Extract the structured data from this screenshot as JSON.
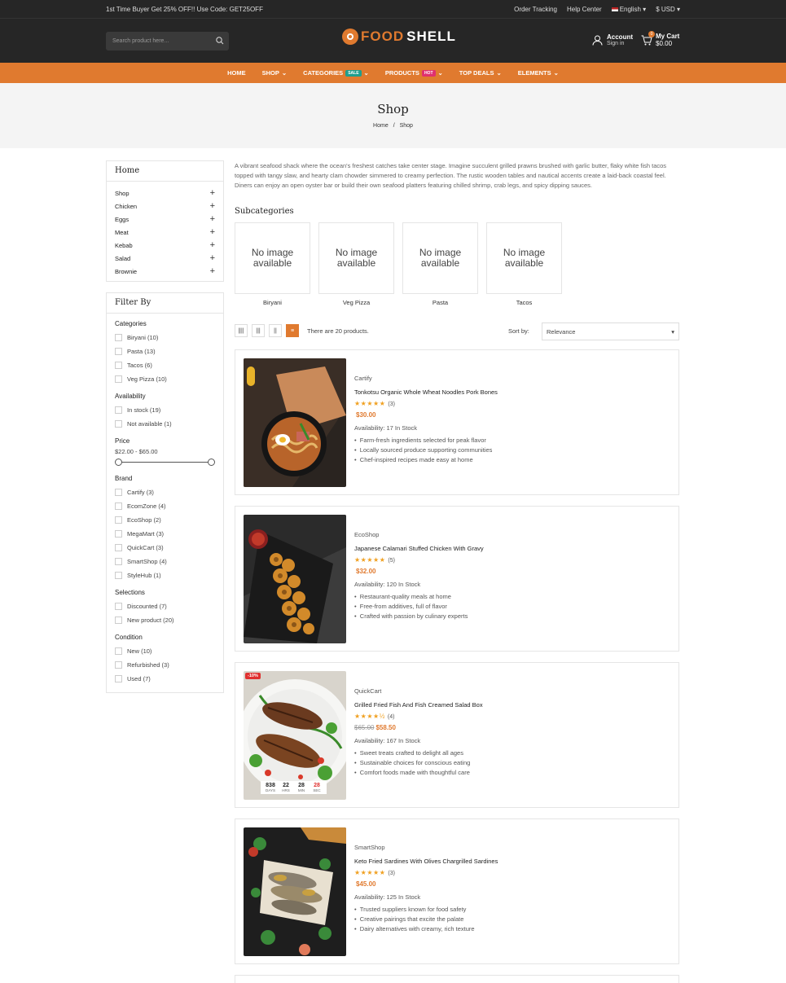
{
  "topbar": {
    "promo": "1st Time Buyer Get 25% OFF!! Use Code: GET25OFF",
    "order_tracking": "Order Tracking",
    "help_center": "Help Center",
    "language": "English",
    "currency": "$ USD"
  },
  "header": {
    "search_placeholder": "Search product here...",
    "logo_part1": "FOOD",
    "logo_part2": "SHELL",
    "account_label": "Account",
    "account_sub": "Sign in",
    "cart_label": "My Cart",
    "cart_total": "$0.00",
    "cart_count": "0"
  },
  "nav": {
    "items": [
      "HOME",
      "SHOP",
      "CATEGORIES",
      "PRODUCTS",
      "TOP DEALS",
      "ELEMENTS"
    ],
    "sale_tag": "SALE",
    "hot_tag": "HOT"
  },
  "banner": {
    "title": "Shop",
    "crumb_home": "Home",
    "crumb_sep": "/",
    "crumb_current": "Shop"
  },
  "sidebar": {
    "cat_title": "Home",
    "categories": [
      "Shop",
      "Chicken",
      "Eggs",
      "Meat",
      "Kebab",
      "Salad",
      "Brownie"
    ],
    "filter_title": "Filter By",
    "groups": {
      "categories": {
        "title": "Categories",
        "options": [
          "Biryani (10)",
          "Pasta (13)",
          "Tacos (6)",
          "Veg Pizza (10)"
        ]
      },
      "availability": {
        "title": "Availability",
        "options": [
          "In stock (19)",
          "Not available (1)"
        ]
      },
      "price": {
        "title": "Price",
        "range": "$22.00 - $65.00"
      },
      "brand": {
        "title": "Brand",
        "options": [
          "Cartify (3)",
          "EcomZone (4)",
          "EcoShop (2)",
          "MegaMart (3)",
          "QuickCart (3)",
          "SmartShop (4)",
          "StyleHub (1)"
        ]
      },
      "selections": {
        "title": "Selections",
        "options": [
          "Discounted (7)",
          "New product (20)"
        ]
      },
      "condition": {
        "title": "Condition",
        "options": [
          "New (10)",
          "Refurbished (3)",
          "Used (7)"
        ]
      }
    }
  },
  "main": {
    "description": "A vibrant seafood shack where the ocean's freshest catches take center stage. Imagine succulent grilled prawns brushed with garlic butter, flaky white fish tacos topped with tangy slaw, and hearty clam chowder simmered to creamy perfection. The rustic wooden tables and nautical accents create a laid-back coastal feel. Diners can enjoy an open oyster bar or build their own seafood platters featuring chilled shrimp, crab legs, and spicy dipping sauces.",
    "subcategories_title": "Subcategories",
    "no_image": "No image available",
    "subcategories": [
      "Biryani",
      "Veg Pizza",
      "Pasta",
      "Tacos"
    ],
    "product_count": "There are 20 products.",
    "sort_label": "Sort by:",
    "sort_value": "Relevance"
  },
  "products": [
    {
      "brand": "Cartify",
      "name": "Tonkotsu Organic Whole Wheat Noodles Pork Bones",
      "stars": "★★★★★",
      "reviews": "(3)",
      "old_price": "",
      "price": "$30.00",
      "availability": "Availability: 17 In Stock",
      "bullets": [
        "Farm-fresh ingredients selected for peak flavor",
        "Locally sourced produce supporting communities",
        "Chef-inspired recipes made easy at home"
      ]
    },
    {
      "brand": "EcoShop",
      "name": "Japanese Calamari Stuffed Chicken With Gravy",
      "stars": "★★★★★",
      "reviews": "(5)",
      "old_price": "",
      "price": "$32.00",
      "availability": "Availability: 120 In Stock",
      "bullets": [
        "Restaurant-quality meals at home",
        "Free-from additives, full of flavor",
        "Crafted with passion by culinary experts"
      ]
    },
    {
      "brand": "QuickCart",
      "name": "Grilled Fried Fish And Fish Creamed Salad Box",
      "stars": "★★★★½",
      "reviews": "(4)",
      "old_price": "$65.00",
      "price": "$58.50",
      "availability": "Availability: 167 In Stock",
      "bullets": [
        "Sweet treats crafted to delight all ages",
        "Sustainable choices for conscious eating",
        "Comfort foods made with thoughtful care"
      ],
      "discount": "-10%",
      "timer": {
        "days": "838",
        "hrs": "22",
        "min": "28",
        "sec": "28",
        "days_l": "DAYS",
        "hrs_l": "HRS",
        "min_l": "MIN",
        "sec_l": "SEC"
      }
    },
    {
      "brand": "SmartShop",
      "name": "Keto Fried Sardines With Olives Chargrilled Sardines",
      "stars": "★★★★★",
      "reviews": "(3)",
      "old_price": "",
      "price": "$45.00",
      "availability": "Availability: 125 In Stock",
      "bullets": [
        "Trusted suppliers known for food safety",
        "Creative pairings that excite the palate",
        "Dairy alternatives with creamy, rich texture"
      ]
    }
  ],
  "colors": {
    "accent": "#e07a2f",
    "dark": "#262626",
    "sale": "#1e9e8e",
    "hot": "#e0306e"
  }
}
